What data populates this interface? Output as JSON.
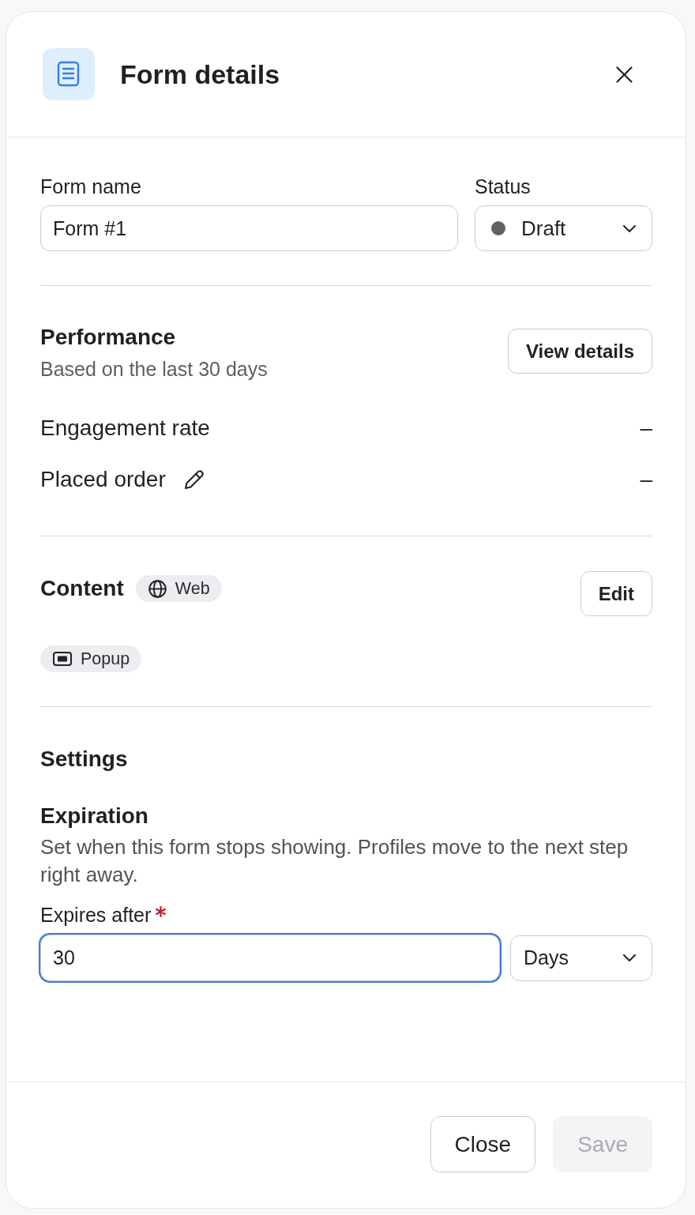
{
  "header": {
    "title": "Form details"
  },
  "general": {
    "name_field": {
      "label": "Form name",
      "value": "Form #1"
    },
    "status_field": {
      "label": "Status",
      "value": "Draft"
    }
  },
  "performance": {
    "title": "Performance",
    "subtitle": "Based on the last 30 days",
    "button": "View details",
    "metrics": [
      {
        "label": "Engagement rate",
        "value": "–",
        "editable": false
      },
      {
        "label": "Placed order",
        "value": "–",
        "editable": true
      }
    ]
  },
  "content": {
    "title": "Content",
    "channel": {
      "label": "Web",
      "kind": "web"
    },
    "button": "Edit",
    "tags": [
      {
        "label": "Popup",
        "kind": "popup"
      }
    ]
  },
  "settings": {
    "title": "Settings",
    "expiration": {
      "title": "Expiration",
      "description": "Set when this form stops showing. Profiles move to the next step right away.",
      "field": {
        "label": "Expires after",
        "required": true,
        "value": "30",
        "focused": true
      },
      "unit": {
        "value": "Days"
      }
    }
  },
  "footer": {
    "buttons": [
      {
        "label": "Close",
        "disabled": false
      },
      {
        "label": "Save",
        "disabled": true
      }
    ]
  }
}
